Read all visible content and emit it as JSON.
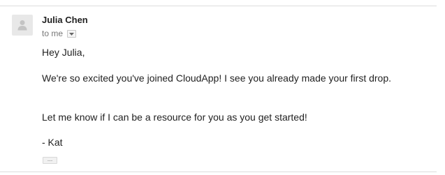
{
  "message": {
    "sender_name": "Julia Chen",
    "recipient_label": "to me",
    "body": {
      "greeting": "Hey Julia,",
      "paragraph1": "We're so excited you've joined CloudApp! I see you already made your first drop.",
      "paragraph2": "Let me know if I can be a resource for you as you get started!",
      "signature": "- Kat"
    },
    "trimmed_content_label": "..."
  },
  "icons": {
    "avatar": "person-silhouette-icon",
    "details_toggle": "chevron-down-icon"
  },
  "colors": {
    "sender_text": "#222222",
    "recipient_text": "#777777",
    "avatar_bg": "#e8e8e8",
    "avatar_glyph": "#c4c4c4",
    "divider": "#dcdcdc"
  }
}
